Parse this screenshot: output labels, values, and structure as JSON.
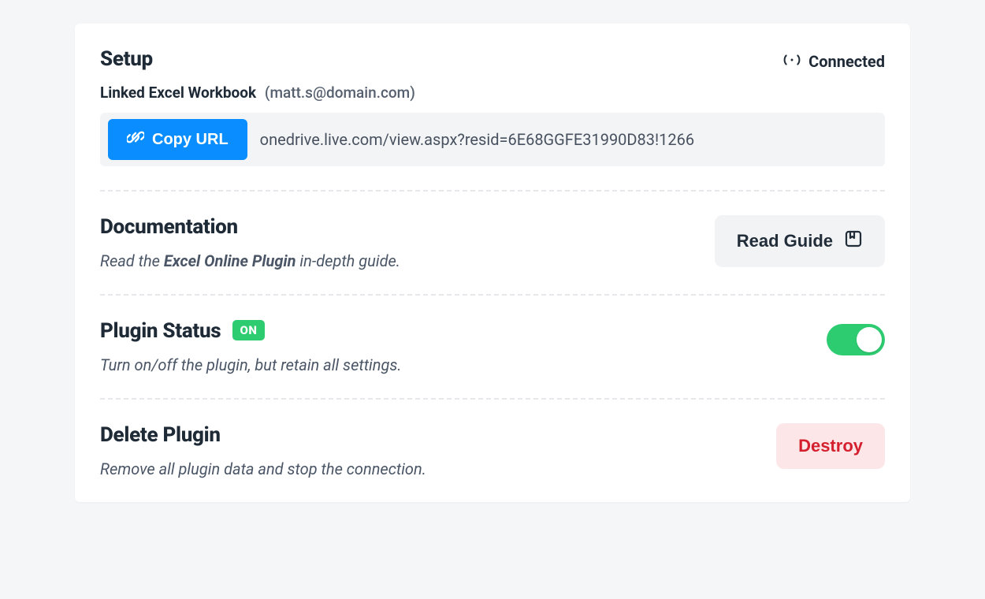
{
  "setup": {
    "heading": "Setup",
    "connected_label": "Connected",
    "linked_label": "Linked Excel Workbook",
    "linked_email": "(matt.s@domain.com)",
    "copy_label": "Copy URL",
    "url": "onedrive.live.com/view.aspx?resid=6E68GGFE31990D83!1266"
  },
  "documentation": {
    "heading": "Documentation",
    "desc_prefix": "Read the ",
    "desc_strong": "Excel Online Plugin",
    "desc_suffix": " in-depth guide.",
    "guide_label": "Read Guide"
  },
  "status": {
    "heading": "Plugin Status",
    "badge": "ON",
    "desc": "Turn on/off the plugin, but retain all settings."
  },
  "delete": {
    "heading": "Delete Plugin",
    "desc": "Remove all plugin data and stop the connection.",
    "destroy_label": "Destroy"
  }
}
